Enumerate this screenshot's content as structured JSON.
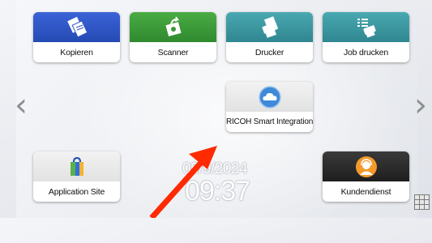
{
  "colors": {
    "blue": "#2f55c8",
    "green": "#3a9a3a",
    "teal": "#3d98a0",
    "dark": "#2a2a2a",
    "pointer": "#ff2a00"
  },
  "tiles": {
    "kopieren": {
      "label": "Kopieren",
      "icon": "copy-icon"
    },
    "scanner": {
      "label": "Scanner",
      "icon": "scanner-icon"
    },
    "drucker": {
      "label": "Drucker",
      "icon": "printer-icon"
    },
    "job_drucken": {
      "label": "Job drucken",
      "icon": "print-job-icon"
    },
    "ricoh": {
      "label": "RICOH Smart Integration",
      "icon": "cloud-icon"
    },
    "app_site": {
      "label": "Application Site",
      "icon": "shopping-bag-icon"
    },
    "kundendienst": {
      "label": "Kundendienst",
      "icon": "support-agent-icon"
    }
  },
  "clock": {
    "date": "09/9/2024",
    "time": "09:37"
  },
  "nav": {
    "prev": "‹",
    "next": "›"
  }
}
